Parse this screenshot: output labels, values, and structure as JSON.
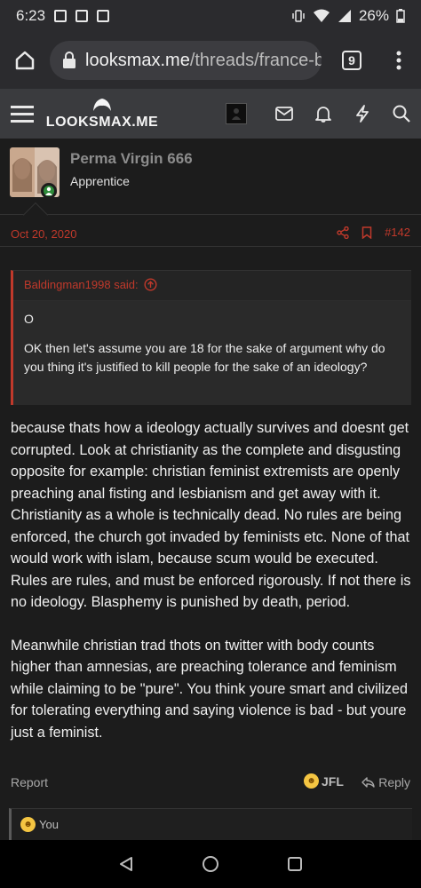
{
  "status_bar": {
    "time": "6:23",
    "battery": "26%"
  },
  "browser": {
    "url_domain": "looksmax.me",
    "url_path": "/threads/france-b",
    "tab_count": "9"
  },
  "site": {
    "logo_text": "LOOKSMAX.ME"
  },
  "post": {
    "username": "Perma Virgin 666",
    "user_title": "Apprentice",
    "date": "Oct 20, 2020",
    "post_number": "#142",
    "quote": {
      "author": "Baldingman1998 said:",
      "line1": "O",
      "line2": "OK then let's assume you are 18 for the sake of argument why do you thing it's justified to kill people for the sake of an ideology?"
    },
    "paragraph1": "because thats how a ideology actually survives and doesnt get corrupted. Look at christianity as the complete and disgusting opposite for example: christian feminist extremists are openly preaching anal fisting and lesbianism and get away with it. Christianity as a whole is technically dead. No rules are being enforced, the church got invaded by feminists etc. None of that would work with islam, because scum would be executed. Rules are rules, and must be enforced rigorously. If not there is no ideology. Blasphemy is punished by death, period.",
    "paragraph2": "Meanwhile christian trad thots on twitter with body counts higher than amnesias, are preaching tolerance and feminism while claiming to be \"pure\". You think youre smart and civilized for tolerating everything and saying violence is bad - but youre just a feminist.",
    "report_label": "Report",
    "reaction_label": "JFL",
    "reply_label": "Reply",
    "reactions_by": "You"
  },
  "colors": {
    "accent": "#c0392b",
    "online": "#2e8b3a"
  }
}
